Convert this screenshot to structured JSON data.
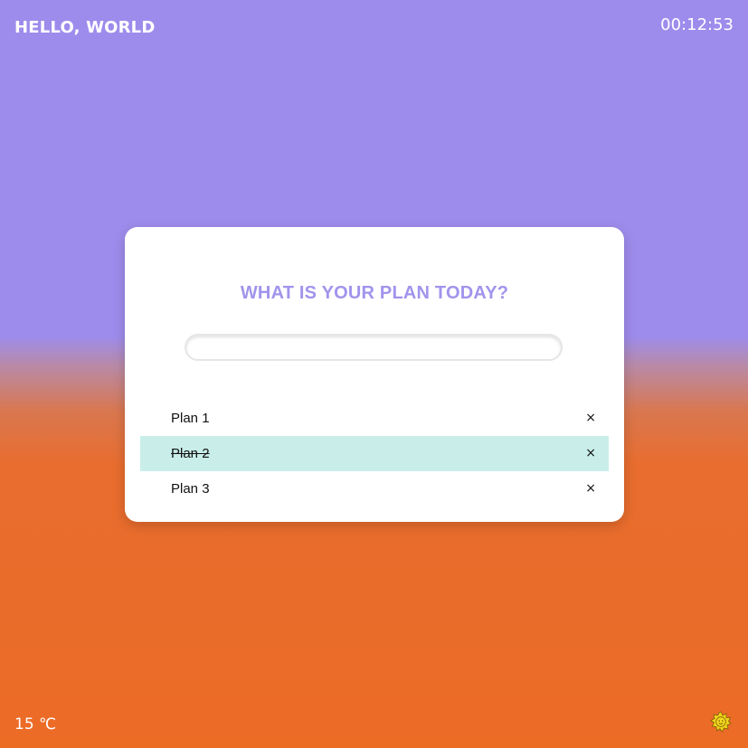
{
  "header": {
    "greeting": "HELLO, WORLD",
    "clock": "00:12:53"
  },
  "footer": {
    "temperature": "15 ℃",
    "weather_icon": "sun-icon"
  },
  "card": {
    "title": "WHAT IS YOUR PLAN TODAY?",
    "input_value": "",
    "input_placeholder": ""
  },
  "plans": [
    {
      "text": "Plan 1",
      "done": false,
      "remove_label": "×"
    },
    {
      "text": "Plan 2",
      "done": true,
      "remove_label": "×"
    },
    {
      "text": "Plan 3",
      "done": false,
      "remove_label": "×"
    }
  ],
  "colors": {
    "background_top": "#9e8cec",
    "background_bottom": "#ec6b25",
    "title_color": "#a094ec",
    "done_highlight": "#c9eeea",
    "sun": "#f2d21b"
  }
}
